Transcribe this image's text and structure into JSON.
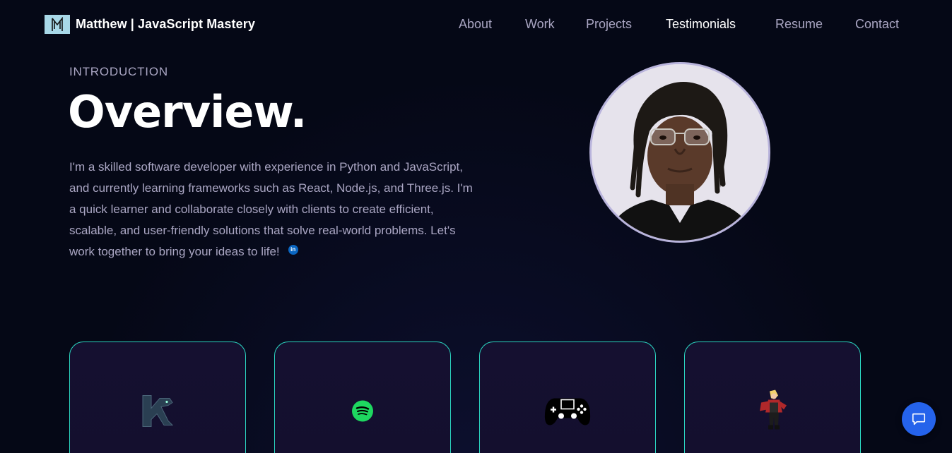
{
  "navbar": {
    "brand": "Matthew | JavaScript Mastery",
    "links": [
      {
        "label": "About"
      },
      {
        "label": "Work"
      },
      {
        "label": "Projects"
      },
      {
        "label": "Testimonials",
        "active": true
      },
      {
        "label": "Resume"
      },
      {
        "label": "Contact"
      }
    ]
  },
  "intro": {
    "label": "INTRODUCTION",
    "title": "Overview.",
    "body": "I'm a skilled software developer with experience in Python and JavaScript, and currently learning frameworks such as React, Node.js, and Three.js. I'm a quick learner and collaborate closely with clients to create efficient, scalable, and user-friendly solutions that solve real-world problems. Let's work together to bring your ideas to life!"
  },
  "linkedin": {
    "text": "in"
  },
  "cards": [
    {
      "icon": "panther-k-icon"
    },
    {
      "icon": "spotify-icon"
    },
    {
      "icon": "gamepad-icon"
    },
    {
      "icon": "anime-character-icon"
    }
  ],
  "colors": {
    "background": "#050816",
    "secondary_text": "#aaa6c3",
    "card_border": "#2bd5c0",
    "card_bg": "#151030",
    "chat_button": "#2563eb",
    "spotify_green": "#1ed760",
    "linkedin_blue": "#0a66c2"
  }
}
